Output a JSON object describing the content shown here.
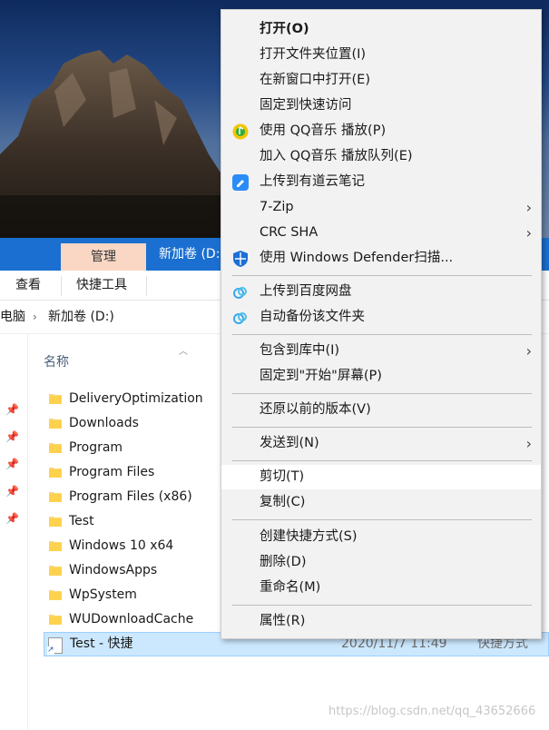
{
  "explorer": {
    "ribbon_context_tab": "管理",
    "title": "新加卷 (D:",
    "ribbon_tabs": [
      "查看",
      "快捷工具"
    ],
    "breadcrumb": [
      "电脑",
      "新加卷 (D:)"
    ],
    "column_name": "名称",
    "files": [
      {
        "name": "DeliveryOptimization"
      },
      {
        "name": "Downloads"
      },
      {
        "name": "Program"
      },
      {
        "name": "Program Files"
      },
      {
        "name": "Program Files (x86)"
      },
      {
        "name": "Test"
      },
      {
        "name": "Windows 10 x64"
      },
      {
        "name": "WindowsApps"
      },
      {
        "name": "WpSystem"
      },
      {
        "name": "WUDownloadCache"
      },
      {
        "name": "Test - 快捷",
        "date": "2020/11/7 11:49",
        "type": "快捷方式",
        "selected": true
      }
    ]
  },
  "context_menu": {
    "items": [
      {
        "label": "打开(O)",
        "bold": true
      },
      {
        "label": "打开文件夹位置(I)"
      },
      {
        "label": "在新窗口中打开(E)"
      },
      {
        "label": "固定到快速访问"
      },
      {
        "label": "使用 QQ音乐 播放(P)",
        "icon": "qqmusic-icon"
      },
      {
        "label": "加入 QQ音乐 播放队列(E)"
      },
      {
        "label": "上传到有道云笔记",
        "icon": "youdao-note-icon"
      },
      {
        "label": "7-Zip",
        "submenu": true
      },
      {
        "label": "CRC SHA",
        "submenu": true
      },
      {
        "label": "使用 Windows Defender扫描...",
        "icon": "defender-shield-icon"
      },
      {
        "label": "上传到百度网盘",
        "icon": "baidu-netdisk-icon"
      },
      {
        "label": "自动备份该文件夹",
        "icon": "baidu-netdisk-icon"
      },
      {
        "label": "包含到库中(I)",
        "submenu": true
      },
      {
        "label": "固定到\"开始\"屏幕(P)"
      },
      {
        "label": "还原以前的版本(V)"
      },
      {
        "label": "发送到(N)",
        "submenu": true
      },
      {
        "label": "剪切(T)",
        "highlighted": true
      },
      {
        "label": "复制(C)"
      },
      {
        "label": "创建快捷方式(S)"
      },
      {
        "label": "删除(D)"
      },
      {
        "label": "重命名(M)"
      },
      {
        "label": "属性(R)"
      }
    ]
  },
  "watermark": "https://blog.csdn.net/qq_43652666",
  "colors": {
    "titlebar": "#1a6fd0",
    "context_tab": "#f9d7c4",
    "selection": "#cce8ff",
    "menu_bg": "#f2f2f2"
  }
}
